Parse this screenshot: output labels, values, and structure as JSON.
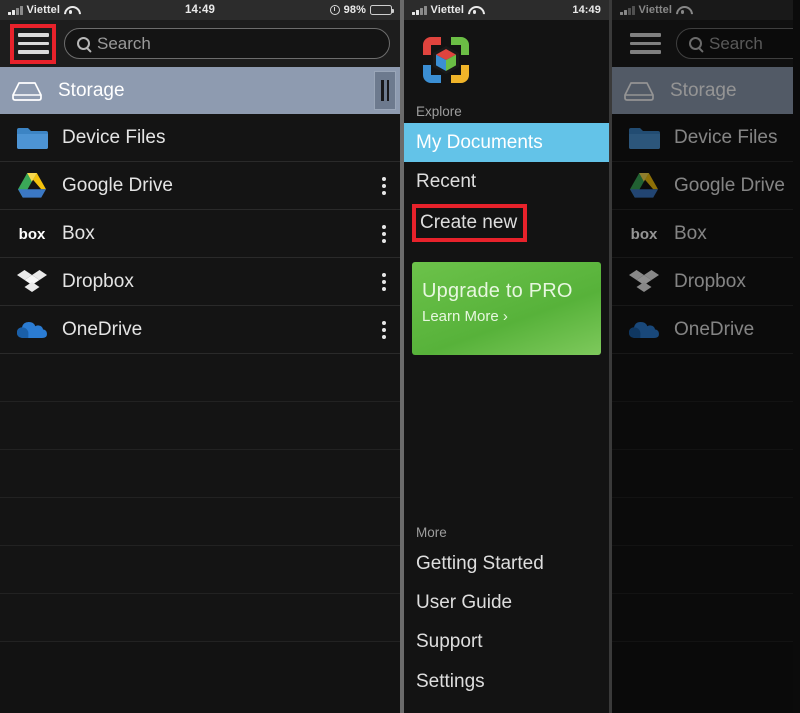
{
  "status_bar": {
    "carrier": "Viettel",
    "time": "14:49",
    "battery_percent": "98%",
    "signal_icon": "signal-bars-icon",
    "wifi_icon": "wifi-icon",
    "lock_icon": "rotation-lock-icon",
    "battery_icon": "battery-icon"
  },
  "toolbar": {
    "menu_icon": "hamburger-menu-icon",
    "search_placeholder": "Search",
    "search_value": "",
    "search_icon": "search-icon"
  },
  "file_browser": {
    "header": {
      "label": "Storage",
      "icon": "hard-drive-icon",
      "grip_icon": "drag-handle-icon"
    },
    "items": [
      {
        "label": "Device Files",
        "icon": "folder-icon",
        "kebab": false
      },
      {
        "label": "Google Drive",
        "icon": "google-drive-icon",
        "kebab": true
      },
      {
        "label": "Box",
        "icon": "box-icon",
        "kebab": true
      },
      {
        "label": "Dropbox",
        "icon": "dropbox-icon",
        "kebab": true
      },
      {
        "label": "OneDrive",
        "icon": "onedrive-icon",
        "kebab": true
      }
    ],
    "empty_rows": 3
  },
  "drawer": {
    "logo_icon": "officesuite-logo-icon",
    "explore_label": "Explore",
    "explore_items": [
      {
        "label": "My Documents",
        "state": "active"
      },
      {
        "label": "Recent",
        "state": "normal"
      },
      {
        "label": "Create new",
        "state": "highlighted"
      }
    ],
    "promo": {
      "title": "Upgrade to PRO",
      "subtitle": "Learn More ›"
    },
    "more_label": "More",
    "more_items": [
      {
        "label": "Getting Started"
      },
      {
        "label": "User Guide"
      },
      {
        "label": "Support"
      },
      {
        "label": "Settings"
      }
    ]
  },
  "colors": {
    "highlight_box": "#e8222b",
    "active_row": "#63c3e8",
    "storage_header": "#8e9bb0",
    "promo_green": "#6cc24a",
    "panel_bg": "#131313"
  }
}
